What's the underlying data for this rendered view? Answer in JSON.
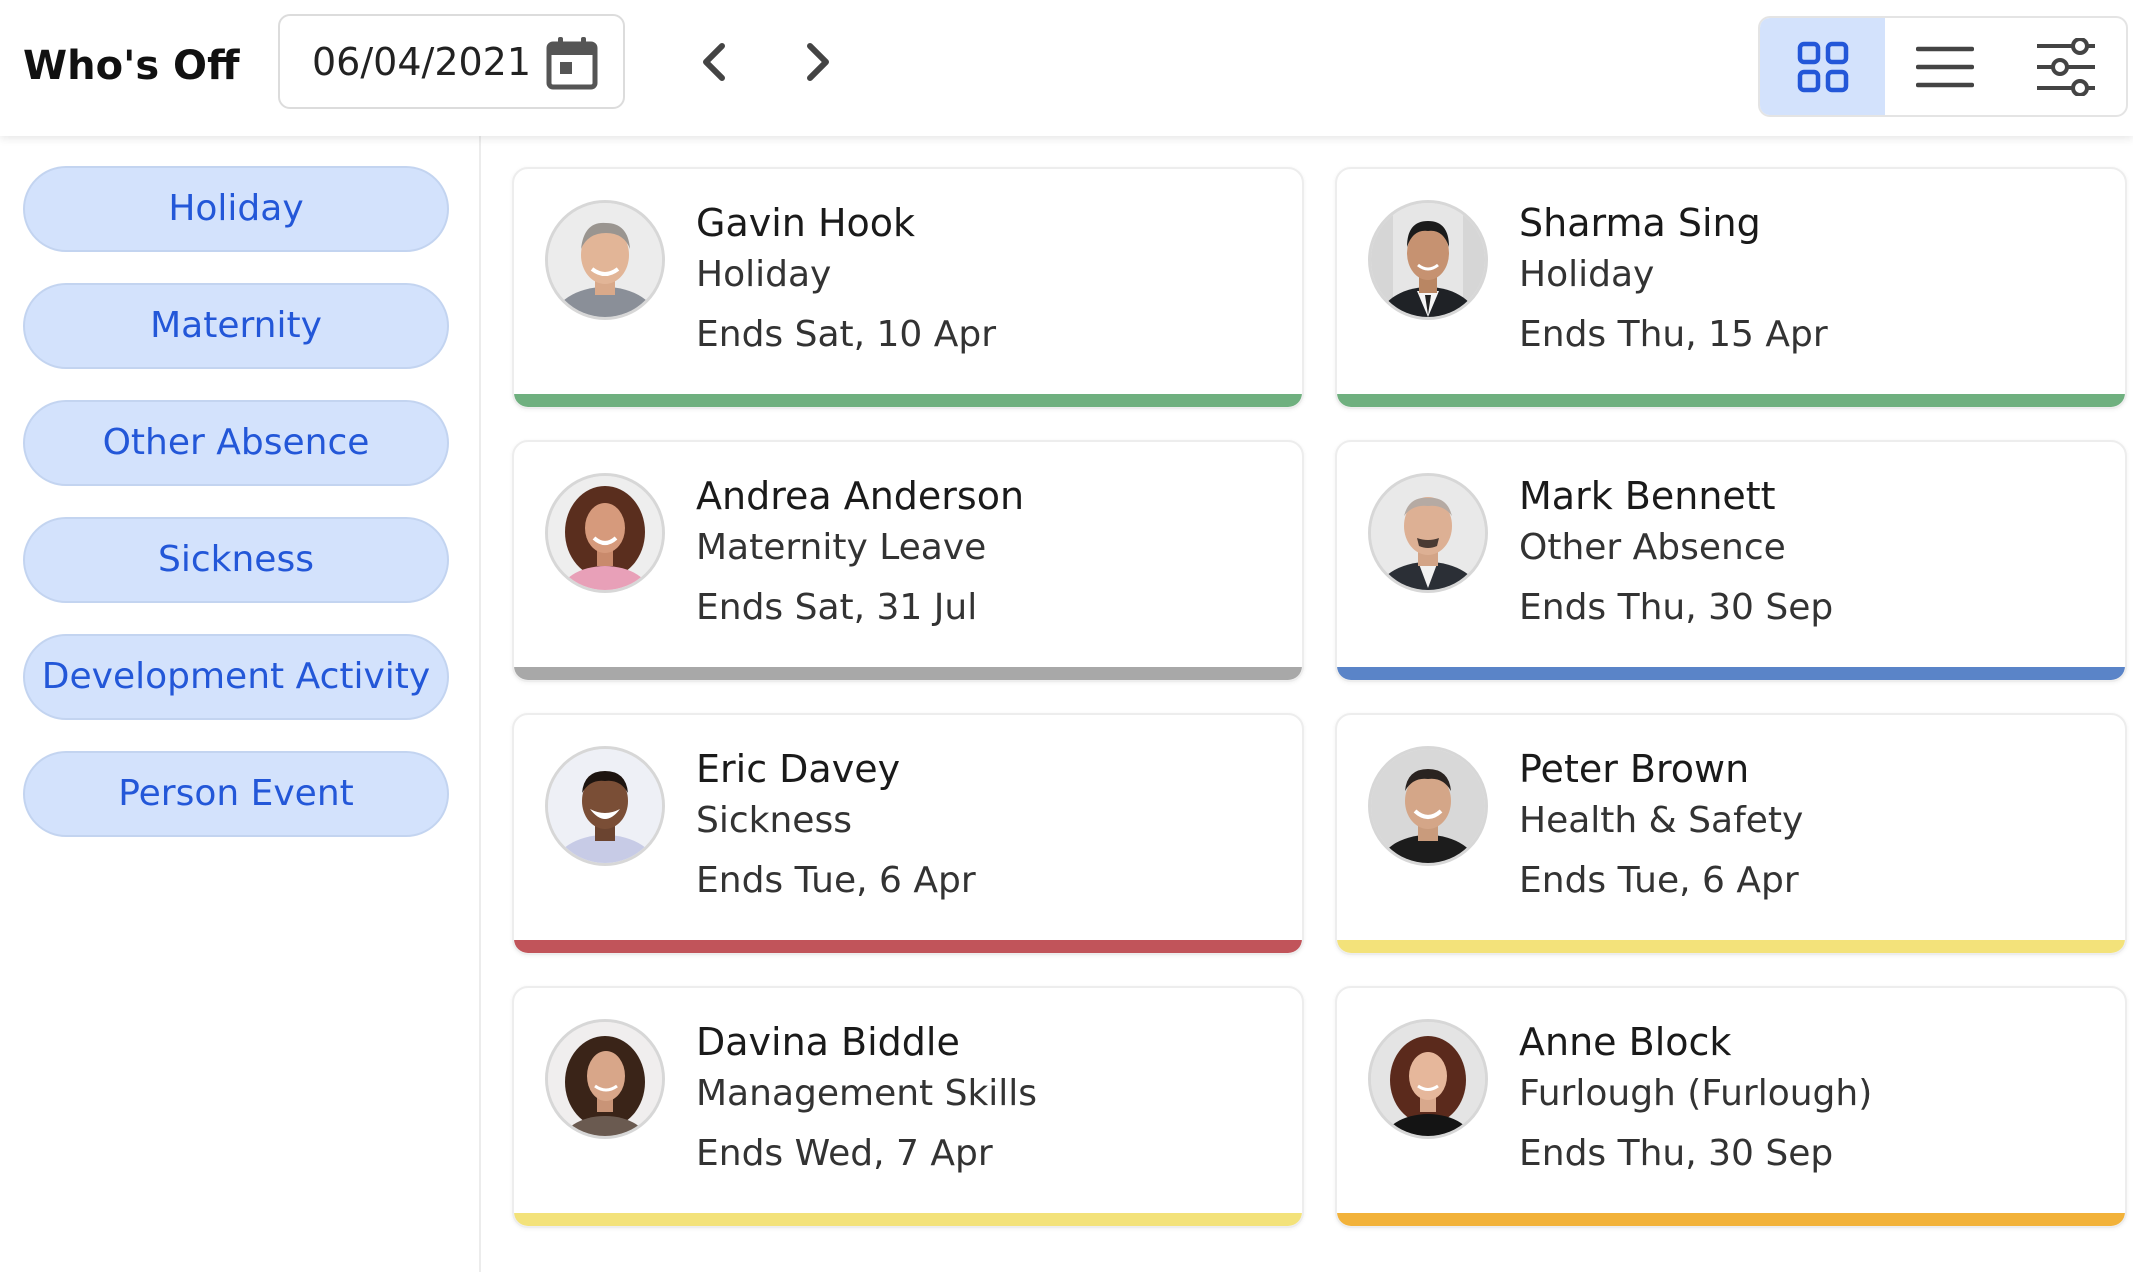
{
  "header": {
    "title": "Who's Off",
    "date_value": "06/04/2021",
    "icons": {
      "calendar": "calendar-icon",
      "prev": "chevron-left-icon",
      "next": "chevron-right-icon",
      "grid_view": "grid-view-icon",
      "list_view": "list-view-icon",
      "filters": "sliders-icon"
    },
    "active_view": "grid"
  },
  "sidebar": {
    "filters": [
      {
        "label": "Holiday"
      },
      {
        "label": "Maternity"
      },
      {
        "label": "Other Absence"
      },
      {
        "label": "Sickness"
      },
      {
        "label": "Development Activity"
      },
      {
        "label": "Person Event"
      }
    ]
  },
  "people": [
    {
      "name": "Gavin Hook",
      "type": "Holiday",
      "ends": "Ends Sat, 10 Apr",
      "color": "#6fb07f"
    },
    {
      "name": "Sharma Sing",
      "type": "Holiday",
      "ends": "Ends Thu, 15 Apr",
      "color": "#6fb07f"
    },
    {
      "name": "Andrea Anderson",
      "type": "Maternity Leave",
      "ends": "Ends Sat, 31 Jul",
      "color": "#a8a8a8"
    },
    {
      "name": "Mark Bennett",
      "type": "Other Absence",
      "ends": "Ends Thu, 30 Sep",
      "color": "#5a84c8"
    },
    {
      "name": "Eric Davey",
      "type": "Sickness",
      "ends": "Ends Tue, 6 Apr",
      "color": "#c1545a"
    },
    {
      "name": "Peter Brown",
      "type": "Health & Safety",
      "ends": "Ends Tue, 6 Apr",
      "color": "#f3e27a"
    },
    {
      "name": "Davina Biddle",
      "type": "Management Skills",
      "ends": "Ends Wed, 7 Apr",
      "color": "#f3e27a"
    },
    {
      "name": "Anne Block",
      "type": "Furlough (Furlough)",
      "ends": "Ends Thu, 30 Sep",
      "color": "#f2b23a"
    }
  ],
  "theme": {
    "accent": "#2357d8",
    "pill_bg": "#d3e2fc"
  }
}
